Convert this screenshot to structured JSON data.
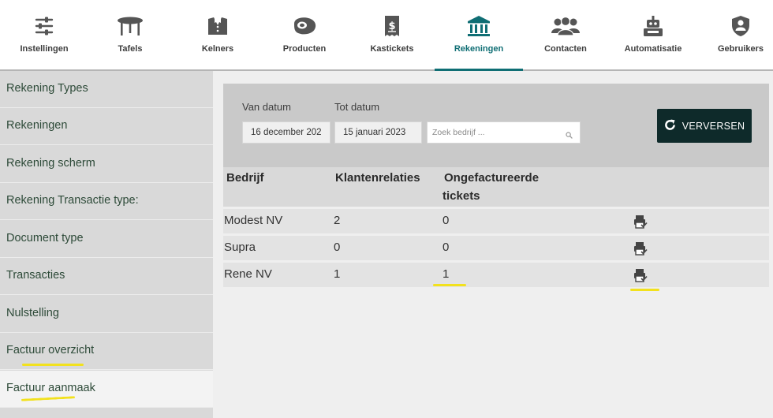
{
  "nav": {
    "items": [
      {
        "label": "Instellingen",
        "icon": "sliders-icon"
      },
      {
        "label": "Tafels",
        "icon": "table-icon"
      },
      {
        "label": "Kelners",
        "icon": "waiter-icon"
      },
      {
        "label": "Producten",
        "icon": "steak-icon"
      },
      {
        "label": "Kastickets",
        "icon": "receipt-icon"
      },
      {
        "label": "Rekeningen",
        "icon": "bank-icon",
        "active": true
      },
      {
        "label": "Contacten",
        "icon": "contacts-icon"
      },
      {
        "label": "Automatisatie",
        "icon": "robot-icon"
      },
      {
        "label": "Gebruikers",
        "icon": "shield-user-icon"
      }
    ]
  },
  "sidebar": {
    "items": [
      {
        "label": "Rekening Types"
      },
      {
        "label": "Rekeningen"
      },
      {
        "label": "Rekening scherm"
      },
      {
        "label": "Rekening Transactie type:"
      },
      {
        "label": "Document type"
      },
      {
        "label": "Transacties"
      },
      {
        "label": "Nulstelling"
      },
      {
        "label": "Factuur overzicht"
      },
      {
        "label": "Factuur aanmaak",
        "selected": true
      }
    ]
  },
  "filters": {
    "from_label": "Van datum",
    "from_value": "16 december 202",
    "to_label": "Tot datum",
    "to_value": "15 januari 2023",
    "search_placeholder": "Zoek bedrijf ...",
    "refresh_label": "VERVERSEN"
  },
  "table": {
    "columns": [
      "Bedrijf",
      "Klantenrelaties",
      "Ongefactureerde",
      "tickets"
    ],
    "rows": [
      {
        "bedrijf": "Modest NV",
        "klantenrelaties": "2",
        "ongefactureerd": "0"
      },
      {
        "bedrijf": "Supra",
        "klantenrelaties": "0",
        "ongefactureerd": "0"
      },
      {
        "bedrijf": "Rene NV",
        "klantenrelaties": "1",
        "ongefactureerd": "1"
      }
    ]
  },
  "colors": {
    "accent": "#0f6e74",
    "button": "#0e2a2a",
    "highlight": "#f2e11d"
  }
}
